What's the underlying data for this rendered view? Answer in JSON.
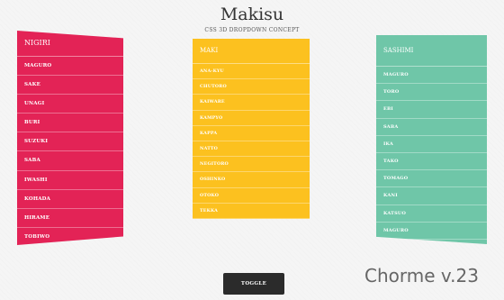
{
  "header": {
    "title": "Makisu",
    "subtitle": "CSS 3D DROPDOWN CONCEPT"
  },
  "panels": [
    {
      "title": "NIGIRI",
      "color": "#e32356",
      "items": [
        "MAGURO",
        "SAKE",
        "UNAGI",
        "BURI",
        "SUZUKI",
        "SABA",
        "IWASHI",
        "KOHADA",
        "HIRAME",
        "TOBIWO"
      ]
    },
    {
      "title": "MAKI",
      "color": "#fcc11f",
      "items": [
        "ANA-KYU",
        "CHUTORO",
        "KAIWARE",
        "KAMPYO",
        "KAPPA",
        "NATTO",
        "NEGITORO",
        "OSHINKO",
        "OTOKO",
        "TEKKA"
      ]
    },
    {
      "title": "SASHIMI",
      "color": "#6fc6a8",
      "items": [
        "MAGURO",
        "TORO",
        "EBI",
        "SABA",
        "IKA",
        "TAKO",
        "TOMAGO",
        "KANI",
        "KATSUO",
        "MAGURO"
      ]
    }
  ],
  "footer": {
    "toggle_label": "TOGGLE",
    "version_text": "Chorme v.23"
  }
}
